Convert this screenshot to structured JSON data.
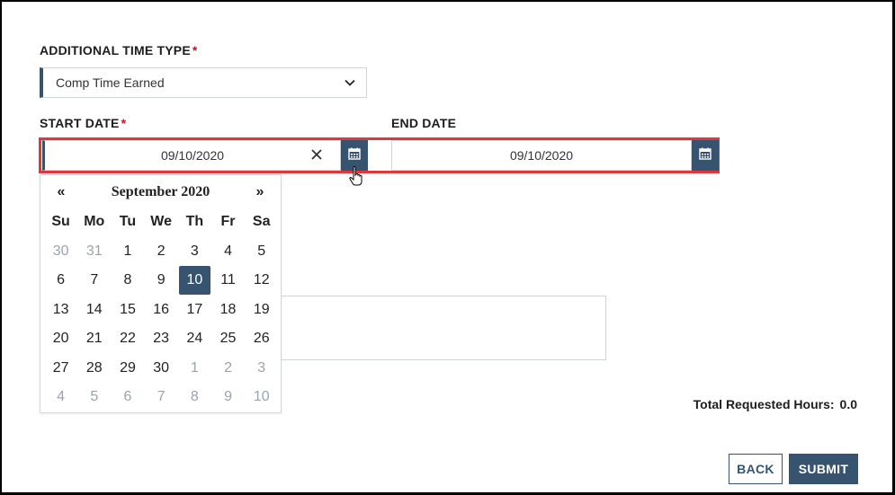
{
  "form": {
    "time_type": {
      "label": "ADDITIONAL TIME TYPE",
      "required_mark": "*",
      "selected": "Comp Time Earned"
    },
    "start_date": {
      "label": "START DATE",
      "required_mark": "*",
      "value": "09/10/2020"
    },
    "end_date": {
      "label": "END DATE",
      "value": "09/10/2020"
    },
    "total": {
      "label": "Total Requested Hours:",
      "value": "0.0"
    },
    "buttons": {
      "back": "BACK",
      "submit": "SUBMIT"
    }
  },
  "datepicker": {
    "prev": "«",
    "next": "»",
    "month_title": "September 2020",
    "weekdays": [
      "Su",
      "Mo",
      "Tu",
      "We",
      "Th",
      "Fr",
      "Sa"
    ],
    "selected_day": "10",
    "weeks": [
      [
        "30",
        "31",
        "1",
        "2",
        "3",
        "4",
        "5"
      ],
      [
        "6",
        "7",
        "8",
        "9",
        "10",
        "11",
        "12"
      ],
      [
        "13",
        "14",
        "15",
        "16",
        "17",
        "18",
        "19"
      ],
      [
        "20",
        "21",
        "22",
        "23",
        "24",
        "25",
        "26"
      ],
      [
        "27",
        "28",
        "29",
        "30",
        "1",
        "2",
        "3"
      ],
      [
        "4",
        "5",
        "6",
        "7",
        "8",
        "9",
        "10"
      ]
    ]
  },
  "colors": {
    "accent": "#365370",
    "highlight": "#e0373f",
    "required": "#c8102e",
    "muted_day": "#9aa4ae"
  },
  "icons": [
    "chevron-down-icon",
    "clear-icon",
    "calendar-icon",
    "hand-cursor-icon"
  ]
}
